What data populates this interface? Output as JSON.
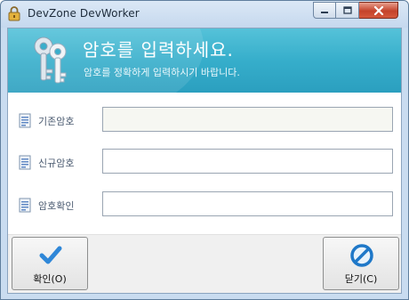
{
  "window": {
    "title": "DevZone DevWorker"
  },
  "titlebar_controls": [
    "minimize-icon",
    "maximize-icon",
    "close-icon"
  ],
  "banner": {
    "title": "암호를 입력하세요.",
    "subtitle": "암호를 정확하게 입력하시기 바랍니다.",
    "icon": "keys-icon"
  },
  "form": {
    "fields": [
      {
        "label": "기존암호",
        "value": "",
        "icon": "document-icon"
      },
      {
        "label": "신규암호",
        "value": "",
        "icon": "document-icon"
      },
      {
        "label": "암호확인",
        "value": "",
        "icon": "document-icon"
      }
    ]
  },
  "buttons": {
    "ok_label": "확인(O)",
    "close_label": "닫기(C)"
  },
  "colors": {
    "banner": "#36aecb",
    "ok_check": "#2f87d8",
    "close_icon": "#1f78c8"
  }
}
